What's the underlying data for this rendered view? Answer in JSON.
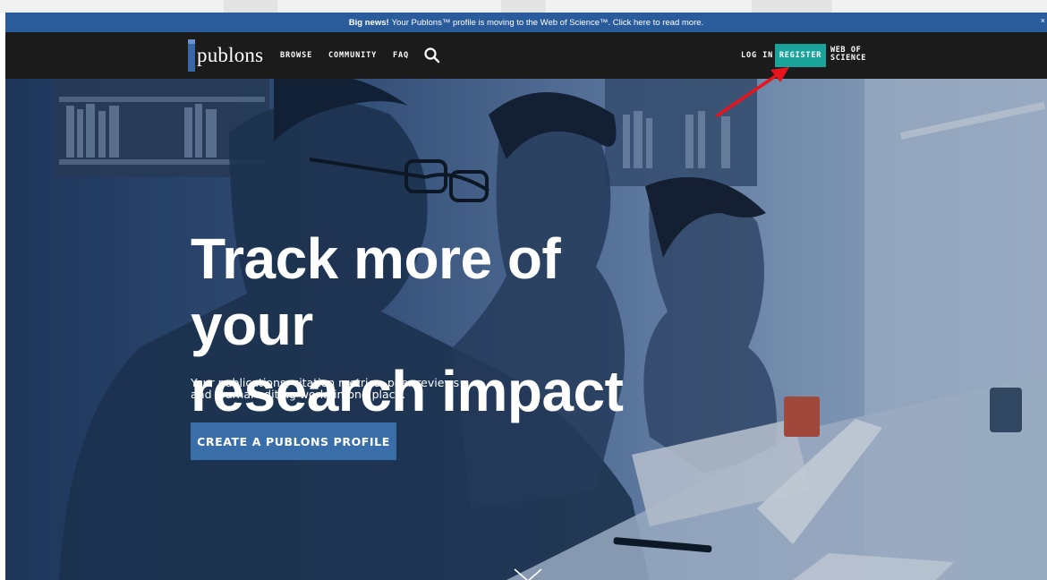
{
  "banner": {
    "bold": "Big news!",
    "text": "Your Publons™ profile is moving to the Web of Science™. Click here to read more.",
    "close": "×"
  },
  "navbar": {
    "logo_text": "publons",
    "links": [
      "BROWSE",
      "COMMUNITY",
      "FAQ"
    ],
    "search_icon": "search-icon",
    "login": "LOG IN",
    "register": "REGISTER",
    "web_of_science": [
      "WEB OF",
      "SCIENCE"
    ]
  },
  "hero": {
    "title_lines": [
      "Track more of your",
      "research impact"
    ],
    "subtitle_lines": [
      "Your publications, citation metrics, peer reviews",
      "and journal editing work, in one place."
    ],
    "cta": "CREATE A PUBLONS PROFILE",
    "scroll_icon": "chevron-down-icon"
  },
  "colors": {
    "banner": "#2a5b9a",
    "navbar": "#1b1b1b",
    "register": "#1aa39a",
    "cta": "#3a6ea8",
    "annotation_arrow": "#e8141c"
  }
}
